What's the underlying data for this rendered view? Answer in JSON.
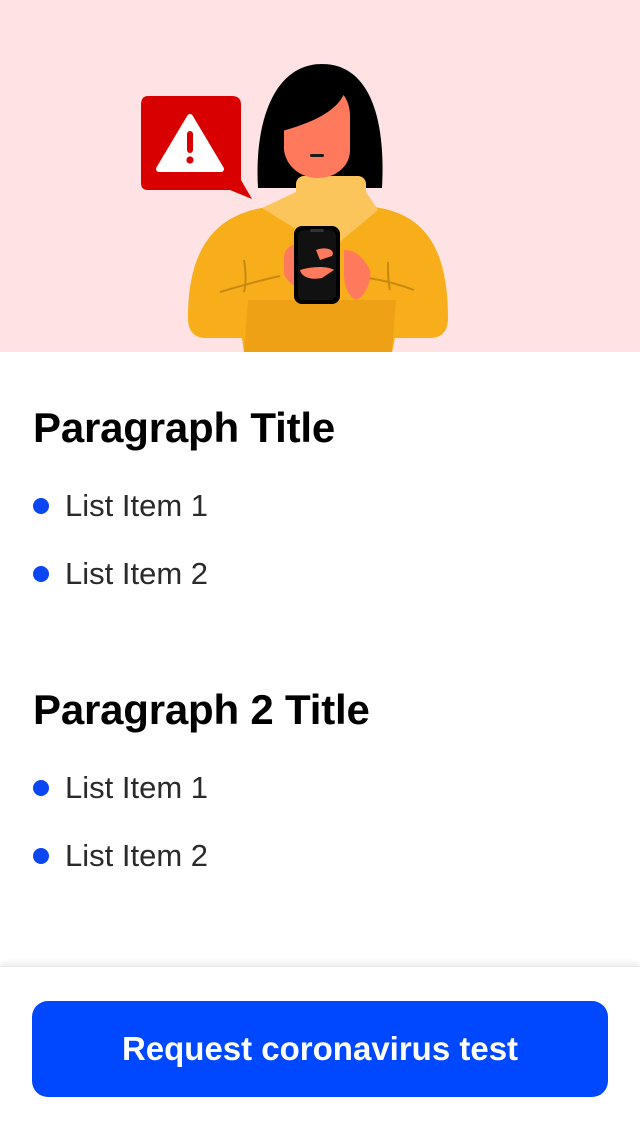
{
  "hero": {
    "illustration": "woman-holding-phone-with-warning",
    "icon": "warning-icon",
    "colors": {
      "background": "#ffe2e3",
      "alert_bubble": "#d80000",
      "sweater": "#f7ae1a",
      "skin": "#ff7a5c",
      "hair": "#000000"
    }
  },
  "sections": [
    {
      "title": "Paragraph Title",
      "items": [
        "List Item 1",
        "List Item 2"
      ]
    },
    {
      "title": "Paragraph 2 Title",
      "items": [
        "List Item 1",
        "List Item 2"
      ]
    }
  ],
  "footer": {
    "cta_label": "Request coronavirus test"
  },
  "colors": {
    "accent": "#0048ff",
    "bullet": "#0a47f2"
  }
}
